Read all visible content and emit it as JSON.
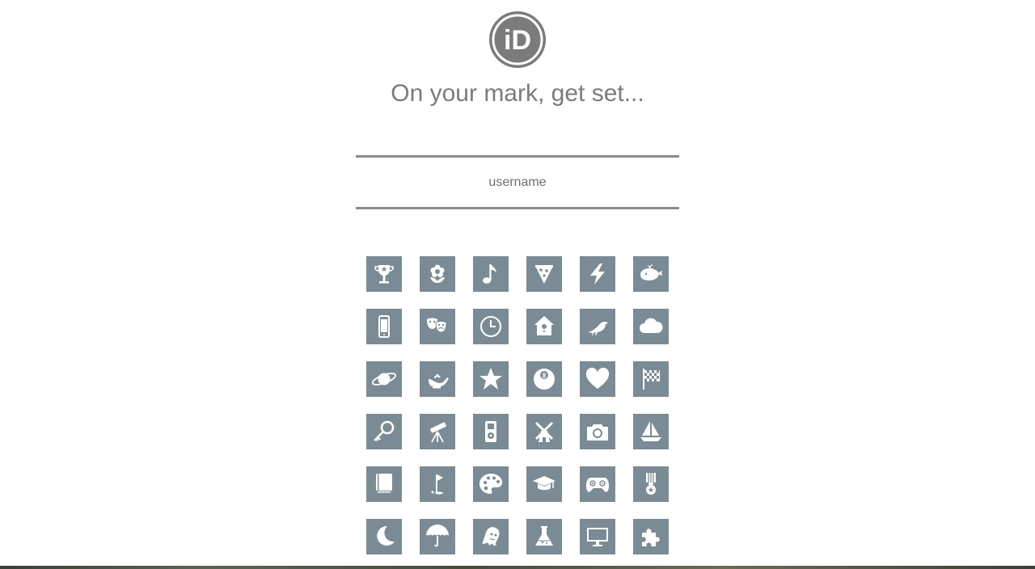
{
  "brand": {
    "logo_text": "iD",
    "logo_icon": "id-logo-icon"
  },
  "heading": "On your mark, get set...",
  "username_field": {
    "placeholder": "username",
    "value": ""
  },
  "colors": {
    "tile": "#7a8b95",
    "text": "#7b7b7b",
    "rule": "#8a8a8a"
  },
  "avatars": [
    [
      "trophy-icon",
      "flower-icon",
      "music-note-icon",
      "pizza-icon",
      "lightning-icon",
      "whale-icon"
    ],
    [
      "phone-icon",
      "theater-masks-icon",
      "clock-icon",
      "birdhouse-icon",
      "bird-icon",
      "cloud-icon"
    ],
    [
      "planet-icon",
      "genie-lamp-icon",
      "star-icon",
      "eight-ball-icon",
      "heart-icon",
      "checkered-flag-icon"
    ],
    [
      "key-icon",
      "telescope-icon",
      "music-player-icon",
      "windmill-icon",
      "camera-icon",
      "sailboat-icon"
    ],
    [
      "book-icon",
      "golf-flag-icon",
      "palette-icon",
      "graduation-cap-icon",
      "gamepad-icon",
      "medal-icon"
    ],
    [
      "moon-icon",
      "umbrella-icon",
      "ghost-icon",
      "flask-icon",
      "monitor-icon",
      "puzzle-icon"
    ]
  ]
}
